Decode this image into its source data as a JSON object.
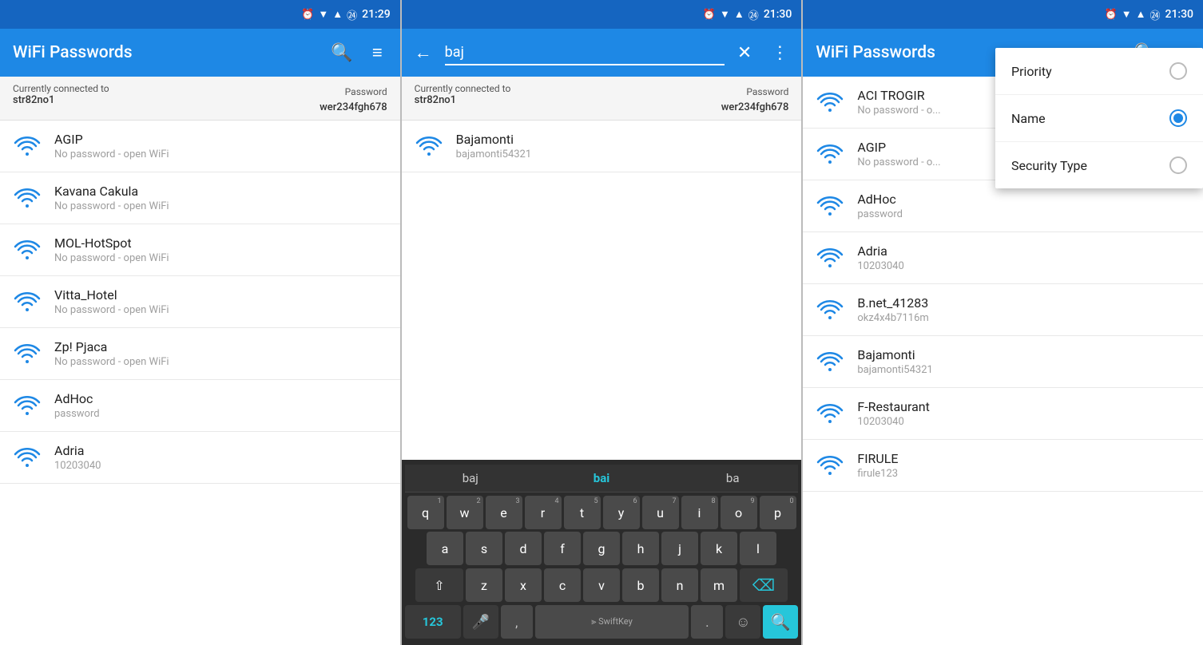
{
  "panel1": {
    "statusBar": {
      "time": "21:29"
    },
    "appBar": {
      "title": "WiFi Passwords",
      "searchIcon": "🔍",
      "filterIcon": "≡"
    },
    "connectedBar": {
      "label": "Currently connected to",
      "network": "str82no1",
      "passwordLabel": "Password",
      "password": "wer234fgh678"
    },
    "wifiList": [
      {
        "name": "AGIP",
        "password": "No password - open WiFi"
      },
      {
        "name": "Kavana Cakula",
        "password": "No password - open WiFi"
      },
      {
        "name": "MOL-HotSpot",
        "password": "No password - open WiFi"
      },
      {
        "name": "Vitta_Hotel",
        "password": "No password - open WiFi"
      },
      {
        "name": "Zp! Pjaca",
        "password": "No password - open WiFi"
      },
      {
        "name": "AdHoc",
        "password": "password"
      },
      {
        "name": "Adria",
        "password": "10203040"
      }
    ]
  },
  "panel2": {
    "statusBar": {
      "time": "21:30"
    },
    "searchBar": {
      "backIcon": "←",
      "query": "baj",
      "clearIcon": "✕",
      "moreIcon": "⋮"
    },
    "connectedBar": {
      "label": "Currently connected to",
      "network": "str82no1",
      "passwordLabel": "Password",
      "password": "wer234fgh678"
    },
    "results": [
      {
        "name": "Bajamonti",
        "password": "bajamonti54321"
      }
    ],
    "keyboard": {
      "suggestions": [
        "baj",
        "bai",
        "ba"
      ],
      "highlightIndex": 1,
      "rows": [
        [
          "q",
          "w",
          "e",
          "r",
          "t",
          "y",
          "u",
          "i",
          "o",
          "p"
        ],
        [
          "a",
          "s",
          "d",
          "f",
          "g",
          "h",
          "j",
          "k",
          "l"
        ],
        [
          "z",
          "x",
          "c",
          "v",
          "b",
          "n",
          "m"
        ]
      ],
      "numHints": [
        "1",
        "2",
        "3",
        "4",
        "5",
        "6",
        "7",
        "8",
        "9",
        "0"
      ],
      "label123": "123",
      "swiftkeyLabel": "SwiftKey",
      "period": ".",
      "comma": ","
    }
  },
  "panel3": {
    "statusBar": {
      "time": "21:30"
    },
    "appBar": {
      "title": "WiFi Passwords",
      "searchIcon": "🔍",
      "filterIcon": "≡"
    },
    "wifiList": [
      {
        "name": "ACI TROGIR",
        "password": "No password - o..."
      },
      {
        "name": "AGIP",
        "password": "No password - o..."
      },
      {
        "name": "AdHoc",
        "password": "password"
      },
      {
        "name": "Adria",
        "password": "10203040"
      },
      {
        "name": "B.net_41283",
        "password": "okz4x4b7116m"
      },
      {
        "name": "Bajamonti",
        "password": "bajamonti54321"
      },
      {
        "name": "F-Restaurant",
        "password": "10203040"
      },
      {
        "name": "FIRULE",
        "password": "firule123"
      }
    ],
    "dropdown": {
      "items": [
        {
          "label": "Priority",
          "selected": false
        },
        {
          "label": "Name",
          "selected": true
        },
        {
          "label": "Security Type",
          "selected": false
        }
      ]
    }
  }
}
